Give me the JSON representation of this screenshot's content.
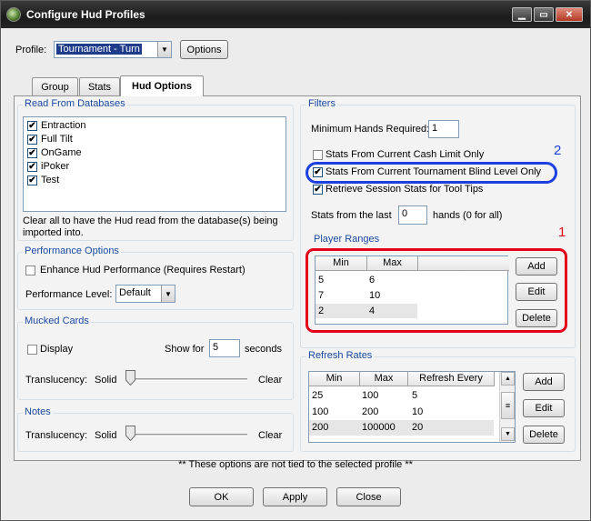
{
  "window": {
    "title": "Configure Hud Profiles"
  },
  "profile": {
    "label": "Profile:",
    "value": "Tournament - Turn",
    "options_button": "Options"
  },
  "tabs": [
    {
      "label": "Group"
    },
    {
      "label": "Stats"
    },
    {
      "label": "Hud Options",
      "active": true
    }
  ],
  "read_from_databases": {
    "legend": "Read From Databases",
    "items": [
      {
        "label": "Entraction",
        "checked": true
      },
      {
        "label": "Full Tilt",
        "checked": true
      },
      {
        "label": "OnGame",
        "checked": true
      },
      {
        "label": "iPoker",
        "checked": true
      },
      {
        "label": "Test",
        "checked": true
      }
    ],
    "note": "Clear all to have the Hud read from the database(s) being imported into."
  },
  "performance": {
    "legend": "Performance Options",
    "enhance_label": "Enhance Hud Performance (Requires Restart)",
    "enhance_checked": false,
    "level_label": "Performance Level:",
    "level_value": "Default"
  },
  "mucked_cards": {
    "legend": "Mucked Cards",
    "display_label": "Display",
    "display_checked": false,
    "show_for_label": "Show for",
    "show_for_value": "5",
    "seconds_label": "seconds",
    "translucency_label": "Translucency:",
    "solid_label": "Solid",
    "clear_label": "Clear",
    "translucency_value": 0
  },
  "notes": {
    "legend": "Notes",
    "translucency_label": "Translucency:",
    "solid_label": "Solid",
    "clear_label": "Clear",
    "translucency_value": 0
  },
  "filters": {
    "legend": "Filters",
    "min_hands_label": "Minimum Hands Required:",
    "min_hands_value": "1",
    "cash_limit_label": "Stats From Current Cash Limit Only",
    "cash_limit_checked": false,
    "tournament_label": "Stats From Current Tournament Blind Level Only",
    "tournament_checked": true,
    "session_label": "Retrieve Session Stats for Tool Tips",
    "session_checked": true,
    "last_label": "Stats from the last",
    "last_value": "0",
    "hands_label": "hands (0 for all)"
  },
  "player_ranges": {
    "legend": "Player Ranges",
    "columns": [
      "Min",
      "Max"
    ],
    "rows": [
      [
        "5",
        "6"
      ],
      [
        "7",
        "10"
      ],
      [
        "2",
        "4"
      ]
    ],
    "add": "Add",
    "edit": "Edit",
    "delete": "Delete"
  },
  "refresh_rates": {
    "legend": "Refresh Rates",
    "columns": [
      "Min",
      "Max",
      "Refresh Every"
    ],
    "rows": [
      [
        "25",
        "100",
        "5"
      ],
      [
        "100",
        "200",
        "10"
      ],
      [
        "200",
        "100000",
        "20"
      ]
    ],
    "add": "Add",
    "edit": "Edit",
    "delete": "Delete"
  },
  "footer_note": "** These options are not tied to the selected profile **",
  "buttons": {
    "ok": "OK",
    "apply": "Apply",
    "close": "Close"
  },
  "annotations": {
    "number_1": "1",
    "number_2": "2",
    "red_color": "#e4001b",
    "blue_color": "#1b3fe0"
  }
}
